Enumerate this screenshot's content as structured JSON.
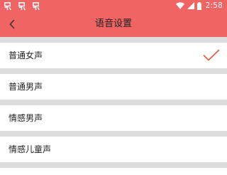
{
  "status_bar": {
    "time": "2:58",
    "notification_icons": [
      "notification-icon",
      "notification-icon",
      "notification-icon"
    ],
    "system_icons": [
      "wifi-icon",
      "signal-icon",
      "battery-icon"
    ]
  },
  "toolbar": {
    "title": "语音设置",
    "back_icon": "chevron-left-icon",
    "background": "#f06464"
  },
  "voice_options": [
    {
      "label": "普通女声",
      "selected": true
    },
    {
      "label": "普通男声",
      "selected": false
    },
    {
      "label": "情感男声",
      "selected": false
    },
    {
      "label": "情感儿童声",
      "selected": false
    }
  ],
  "colors": {
    "accent": "#f06464",
    "check": "#e05a3a",
    "divider": "#dddddd"
  }
}
